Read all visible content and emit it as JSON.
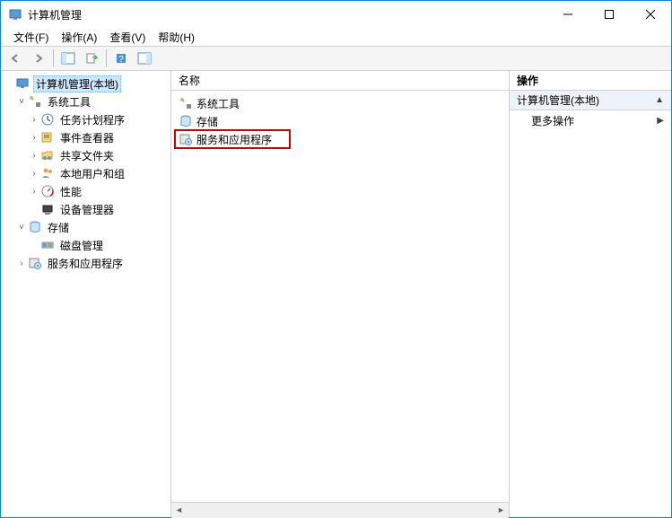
{
  "window": {
    "title": "计算机管理"
  },
  "menu": {
    "file": "文件(F)",
    "action": "操作(A)",
    "view": "查看(V)",
    "help": "帮助(H)"
  },
  "tree": {
    "root": "计算机管理(本地)",
    "system_tools": "系统工具",
    "task_scheduler": "任务计划程序",
    "event_viewer": "事件查看器",
    "shared_folders": "共享文件夹",
    "local_users": "本地用户和组",
    "performance": "性能",
    "device_manager": "设备管理器",
    "storage": "存储",
    "disk_management": "磁盘管理",
    "services_apps": "服务和应用程序"
  },
  "list": {
    "header_name": "名称",
    "items": [
      {
        "label": "系统工具"
      },
      {
        "label": "存储"
      },
      {
        "label": "服务和应用程序"
      }
    ]
  },
  "actions": {
    "title": "操作",
    "section": "计算机管理(本地)",
    "more": "更多操作"
  }
}
